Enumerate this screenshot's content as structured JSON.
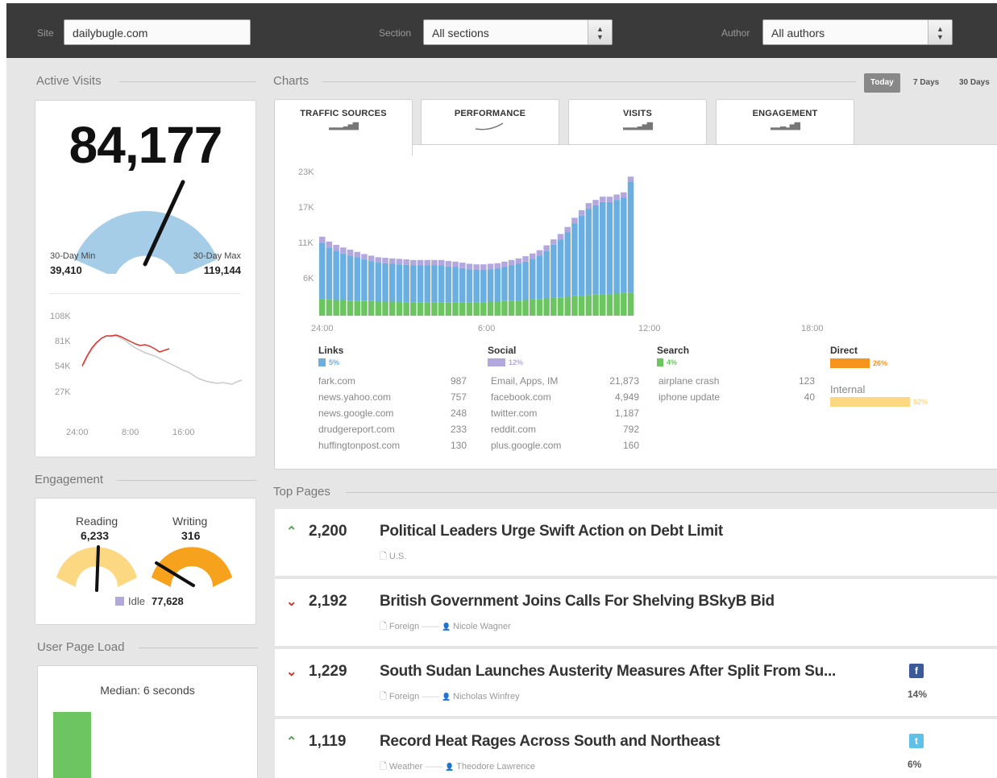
{
  "topbar": {
    "site_label": "Site",
    "site_value": "dailybugle.com",
    "section_label": "Section",
    "section_value": "All sections",
    "author_label": "Author",
    "author_value": "All authors"
  },
  "active_visits": {
    "title": "Active Visits",
    "value": "84,177",
    "min_label": "30-Day Min",
    "min_value": "39,410",
    "max_label": "30-Day Max",
    "max_value": "119,144",
    "gauge_level": 0.6,
    "trend_y_ticks": [
      "108K",
      "81K",
      "54K",
      "27K"
    ],
    "trend_x_ticks": [
      "24:00",
      "8:00",
      "16:00"
    ]
  },
  "charts": {
    "title": "Charts",
    "ranges": [
      "Today",
      "7 Days",
      "30 Days"
    ],
    "tabs": [
      "TRAFFIC SOURCES",
      "PERFORMANCE",
      "VISITS",
      "ENGAGEMENT"
    ]
  },
  "chart_data": {
    "type": "bar",
    "stacked": true,
    "y_ticks": [
      "23K",
      "17K",
      "11K",
      "6K"
    ],
    "x_ticks": [
      "24:00",
      "6:00",
      "12:00",
      "18:00"
    ],
    "ylim": [
      0,
      25000
    ],
    "series": [
      {
        "values": [
          3000,
          3000,
          2900,
          2900,
          2800,
          2800,
          2700,
          2700,
          2600,
          2600,
          2600,
          2600,
          2500,
          2500,
          2500,
          2500,
          2500,
          2500,
          2500,
          2500,
          2500,
          2500,
          2500,
          2500,
          2600,
          2600,
          2700,
          2800,
          2800,
          2900,
          3000,
          3100,
          3200,
          3300,
          3400,
          3500,
          3600,
          3700,
          3800,
          3900,
          4000,
          4000,
          4100,
          4200,
          4200
        ]
      },
      {
        "values": [
          10500,
          9600,
          9100,
          8600,
          8300,
          8000,
          7700,
          7400,
          7200,
          7100,
          7000,
          6900,
          6900,
          6800,
          6800,
          6800,
          6800,
          6800,
          6600,
          6500,
          6300,
          6100,
          6000,
          6000,
          6000,
          6100,
          6300,
          6500,
          6800,
          7100,
          7500,
          8000,
          8800,
          9800,
          10700,
          11900,
          13500,
          14800,
          16000,
          16500,
          17000,
          17000,
          17300,
          17600,
          20500
        ]
      },
      {
        "values": [
          1100,
          1100,
          1100,
          1100,
          1100,
          1000,
          1000,
          1000,
          1000,
          1000,
          1000,
          1000,
          1000,
          1000,
          1000,
          1000,
          1000,
          1000,
          1000,
          1000,
          1000,
          1000,
          1000,
          1000,
          1000,
          1000,
          1000,
          1000,
          1000,
          1000,
          1000,
          1000,
          1000,
          1000,
          1000,
          1000,
          1000,
          1000,
          1000,
          1000,
          1000,
          1000,
          1000,
          1000,
          1000
        ]
      }
    ],
    "colors": [
      "#6cc560",
      "#6baee0",
      "#b3a8de"
    ]
  },
  "sources": {
    "links": {
      "title": "Links",
      "pct": "5%",
      "rows": [
        [
          "fark.com",
          "987"
        ],
        [
          "news.yahoo.com",
          "757"
        ],
        [
          "news.google.com",
          "248"
        ],
        [
          "drudgereport.com",
          "233"
        ],
        [
          "huffingtonpost.com",
          "130"
        ]
      ]
    },
    "social": {
      "title": "Social",
      "pct": "12%",
      "rows": [
        [
          "Email, Apps, IM",
          "21,873"
        ],
        [
          "facebook.com",
          "4,949"
        ],
        [
          "twitter.com",
          "1,187"
        ],
        [
          "reddit.com",
          "792"
        ],
        [
          "plus.google.com",
          "160"
        ]
      ]
    },
    "search": {
      "title": "Search",
      "pct": "4%",
      "rows": [
        [
          "airplane crash",
          "123"
        ],
        [
          "iphone update",
          "40"
        ]
      ]
    },
    "direct": {
      "title": "Direct",
      "pct": "26%",
      "level": 0.26,
      "internal_label": "Internal",
      "internal_pct": "52%",
      "internal_level": 0.52
    }
  },
  "engagement": {
    "title": "Engagement",
    "reading_label": "Reading",
    "reading_value": "6,233",
    "writing_label": "Writing",
    "writing_value": "316",
    "idle_label": "Idle",
    "idle_value": "77,628"
  },
  "page_load": {
    "title": "User Page Load",
    "median": "Median: 6 seconds"
  },
  "top_pages": {
    "title": "Top Pages",
    "rows": [
      {
        "trend": "up",
        "count": "2,200",
        "title": "Political Leaders Urge Swift Action on Debt Limit",
        "section": "U.S.",
        "author": "",
        "social": "",
        "social_pct": ""
      },
      {
        "trend": "down-fast",
        "count": "2,192",
        "title": "British Government Joins Calls For Shelving BSkyB Bid",
        "section": "Foreign",
        "author": "Nicole Wagner",
        "social": "",
        "social_pct": ""
      },
      {
        "trend": "down",
        "count": "1,229",
        "title": "South Sudan Launches Austerity Measures After Split From Su...",
        "section": "Foreign",
        "author": "Nicholas Winfrey",
        "social": "facebook",
        "social_pct": "14%"
      },
      {
        "trend": "up",
        "count": "1,119",
        "title": "Record Heat Rages Across South and Northeast",
        "section": "Weather",
        "author": "Theodore Lawrence",
        "social": "twitter",
        "social_pct": "6%"
      }
    ]
  }
}
